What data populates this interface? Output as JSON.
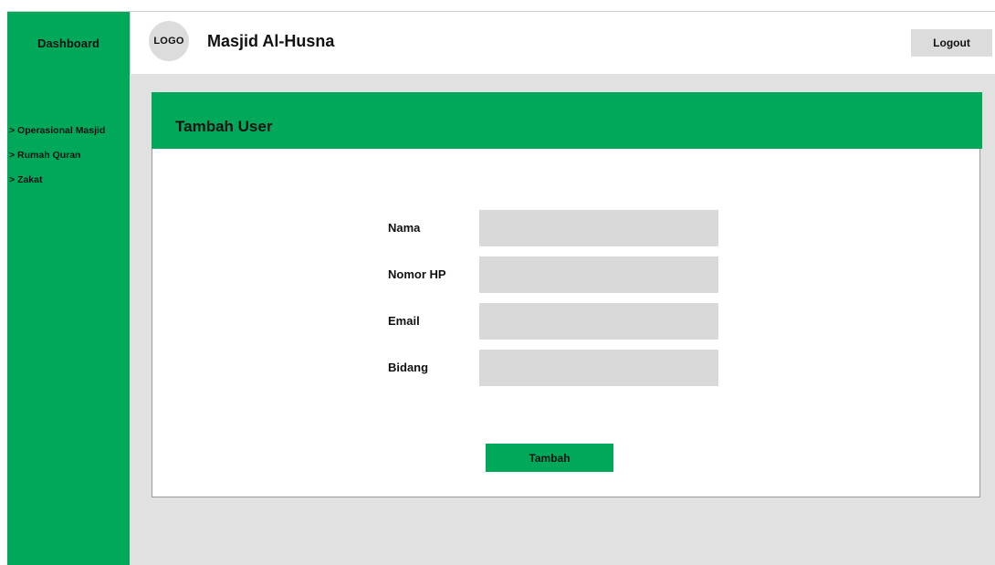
{
  "sidebar": {
    "title": "Dashboard",
    "items": [
      {
        "label": "> Operasional Masjid"
      },
      {
        "label": "> Rumah Quran"
      },
      {
        "label": "> Zakat"
      }
    ]
  },
  "header": {
    "logo_text": "LOGO",
    "title": "Masjid Al-Husna",
    "logout_label": "Logout"
  },
  "form": {
    "title": "Tambah User",
    "fields": [
      {
        "label": "Nama",
        "value": ""
      },
      {
        "label": "Nomor HP",
        "value": ""
      },
      {
        "label": "Email",
        "value": ""
      },
      {
        "label": "Bidang",
        "value": ""
      }
    ],
    "submit_label": "Tambah"
  },
  "colors": {
    "accent": "#00a85a",
    "background": "#e1e1e1",
    "input": "#d9d9d9",
    "logo_circle": "#dcdcdc"
  }
}
